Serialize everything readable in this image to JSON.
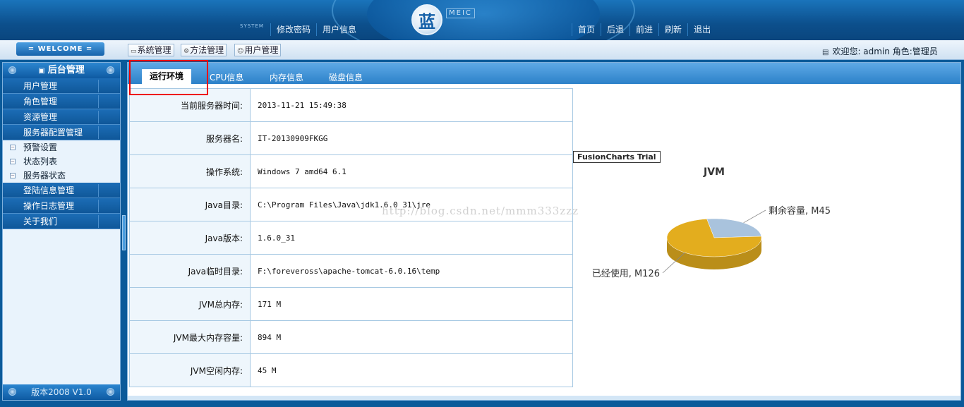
{
  "header": {
    "logo_char": "蓝",
    "logo_sub": "MEIC",
    "system_label": "SYSTEM",
    "left_links": [
      "修改密码",
      "用户信息"
    ],
    "right_links": [
      "首页",
      "后退",
      "前进",
      "刷新",
      "退出"
    ]
  },
  "toolbar": {
    "welcome": "= WELCOME =",
    "buttons": [
      {
        "icon": "monitor-icon",
        "label": "系统管理"
      },
      {
        "icon": "gear-icon",
        "label": "方法管理"
      },
      {
        "icon": "user-icon",
        "label": "用户管理"
      }
    ],
    "user_info": "欢迎您: admin 角色:管理员"
  },
  "sidebar": {
    "title": "后台管理",
    "items": [
      {
        "label": "用户管理",
        "type": "menu"
      },
      {
        "label": "角色管理",
        "type": "menu"
      },
      {
        "label": "资源管理",
        "type": "menu"
      },
      {
        "label": "服务器配置管理",
        "type": "menu"
      },
      {
        "label": "预警设置",
        "type": "sub"
      },
      {
        "label": "状态列表",
        "type": "sub"
      },
      {
        "label": "服务器状态",
        "type": "sub"
      },
      {
        "label": "登陆信息管理",
        "type": "menu"
      },
      {
        "label": "操作日志管理",
        "type": "menu"
      },
      {
        "label": "关于我们",
        "type": "menu"
      }
    ],
    "footer": "版本2008 V1.0"
  },
  "tabs": [
    "运行环境",
    "CPU信息",
    "内存信息",
    "磁盘信息"
  ],
  "active_tab": 0,
  "info_rows": [
    {
      "label": "当前服务器时间:",
      "value": "2013-11-21 15:49:38"
    },
    {
      "label": "服务器名:",
      "value": "IT-20130909FKGG"
    },
    {
      "label": "操作系统:",
      "value": "Windows 7 amd64 6.1"
    },
    {
      "label": "Java目录:",
      "value": "C:\\Program Files\\Java\\jdk1.6.0_31\\jre"
    },
    {
      "label": "Java版本:",
      "value": "1.6.0_31"
    },
    {
      "label": "Java临时目录:",
      "value": "F:\\foreveross\\apache-tomcat-6.0.16\\temp"
    },
    {
      "label": "JVM总内存:",
      "value": "171 M"
    },
    {
      "label": "JVM最大内存容量:",
      "value": "894 M"
    },
    {
      "label": "JVM空闲内存:",
      "value": "45 M"
    }
  ],
  "watermark": "http://blog.csdn.net/mmm333zzz",
  "trial_label": "FusionCharts Trial",
  "chart_data": {
    "type": "pie",
    "title": "JVM",
    "categories": [
      "剩余容量",
      "已经使用"
    ],
    "values": [
      45,
      126
    ],
    "data_labels": [
      "剩余容量, M45",
      "已经使用, M126"
    ],
    "colors": [
      "#a9c3dd",
      "#e3ad1e"
    ]
  }
}
